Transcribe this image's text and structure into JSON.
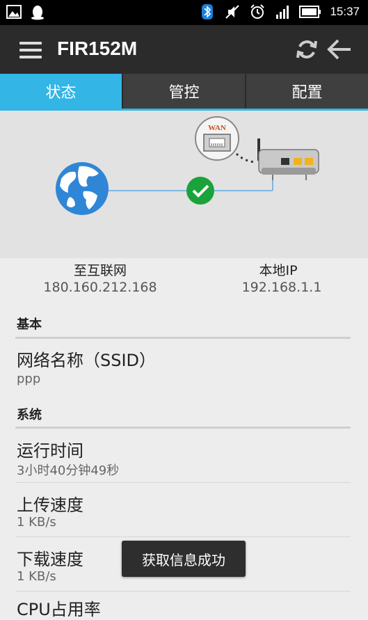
{
  "status_bar": {
    "time": "15:37",
    "icons": [
      "image-icon",
      "qq-penguin-icon",
      "bluetooth-icon",
      "mute-icon",
      "alarm-icon",
      "signal-icon",
      "battery-icon"
    ]
  },
  "header": {
    "title": "FIR152M",
    "icons": [
      "menu-icon",
      "refresh-icon",
      "back-arrow-icon"
    ]
  },
  "tabs": [
    {
      "label": "状态",
      "active": true
    },
    {
      "label": "管控",
      "active": false
    },
    {
      "label": "配置",
      "active": false
    }
  ],
  "diagram": {
    "wan_badge": "WAN",
    "internet_label": "至互联网",
    "internet_ip": "180.160.212.168",
    "local_label": "本地IP",
    "local_ip": "192.168.1.1",
    "connection_status": "connected"
  },
  "sections": {
    "basic": {
      "heading": "基本",
      "ssid_title": "网络名称（SSID）",
      "ssid_value": "ppp"
    },
    "system": {
      "heading": "系统",
      "uptime_title": "运行时间",
      "uptime_value": "3小时40分钟49秒",
      "upload_title": "上传速度",
      "upload_value": "1 KB/s",
      "download_title": "下载速度",
      "download_value": "1 KB/s",
      "cpu_title": "CPU占用率"
    }
  },
  "toast": "获取信息成功",
  "colors": {
    "accent": "#33b5e5",
    "actionbar": "#2b2b2b",
    "check": "#1aa33a",
    "globe": "#2f86d6"
  }
}
